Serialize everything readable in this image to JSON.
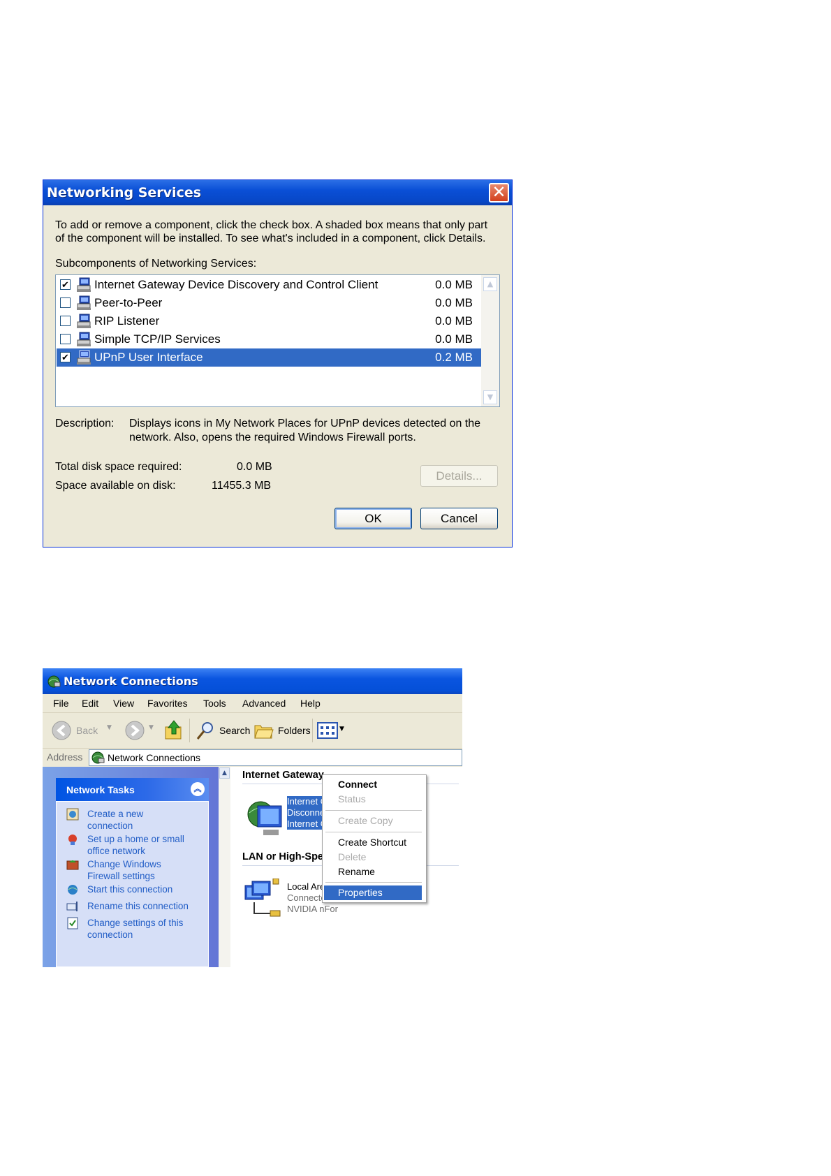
{
  "networking_services": {
    "title": "Networking Services",
    "instructions_line1": "To add or remove a component, click the check box. A shaded box means that only part",
    "instructions_line2": "of the component will be installed. To see what's included in a component, click Details.",
    "subcomponents_label": "Subcomponents of Networking Services:",
    "items": [
      {
        "name": "Internet Gateway Device Discovery and Control Client",
        "size": "0.0 MB",
        "checked": true
      },
      {
        "name": "Peer-to-Peer",
        "size": "0.0 MB",
        "checked": false
      },
      {
        "name": "RIP Listener",
        "size": "0.0 MB",
        "checked": false
      },
      {
        "name": "Simple TCP/IP Services",
        "size": "0.0 MB",
        "checked": false
      },
      {
        "name": "UPnP User Interface",
        "size": "0.2 MB",
        "checked": true,
        "selected": true
      }
    ],
    "description_label": "Description:",
    "description_line1": "Displays icons in My Network Places for UPnP devices detected on the",
    "description_line2": "network. Also, opens the required Windows Firewall ports.",
    "total_disk_label": "Total disk space required:",
    "total_disk_value": "0.0 MB",
    "space_available_label": "Space available on disk:",
    "space_available_value": "11455.3 MB",
    "details_button": "Details...",
    "ok_button": "OK",
    "cancel_button": "Cancel",
    "close_glyph": "✕"
  },
  "network_connections": {
    "title": "Network Connections",
    "menu": [
      "File",
      "Edit",
      "View",
      "Favorites",
      "Tools",
      "Advanced",
      "Help"
    ],
    "toolbar": {
      "back": "Back",
      "search": "Search",
      "folders": "Folders"
    },
    "address_label": "Address",
    "address_value": "Network Connections",
    "tasks_header": "Network Tasks",
    "tasks": [
      {
        "line1": "Create a new",
        "line2": "connection",
        "icon": "new-connection-icon"
      },
      {
        "line1": "Set up a home or small",
        "line2": "office network",
        "icon": "home-network-icon"
      },
      {
        "line1": "Change Windows",
        "line2": "Firewall settings",
        "icon": "firewall-icon"
      },
      {
        "line1": "Start this connection",
        "line2": "",
        "icon": "start-connection-icon"
      },
      {
        "line1": "Rename this connection",
        "line2": "",
        "icon": "rename-icon"
      },
      {
        "line1": "Change settings of this",
        "line2": "connection",
        "icon": "settings-icon"
      }
    ],
    "group_internet_gateway": "Internet Gateway",
    "gateway_item": {
      "line1": "Internet Connection",
      "line2": "Disconnected",
      "line3": "Internet Con"
    },
    "group_lan": "LAN or High-Speed In",
    "lan_item": {
      "line1": "Local Area C",
      "line2": "Connected, I",
      "line3": "NVIDIA nFor"
    },
    "context_menu": [
      {
        "label": "Connect",
        "state": "bold"
      },
      {
        "label": "Status",
        "state": "disabled"
      },
      {
        "label": "Create Copy",
        "state": "disabled"
      },
      {
        "label": "Create Shortcut",
        "state": "normal"
      },
      {
        "label": "Delete",
        "state": "disabled"
      },
      {
        "label": "Rename",
        "state": "normal"
      },
      {
        "label": "Properties",
        "state": "selected"
      }
    ],
    "colors": {
      "selection": "#316ac5",
      "title_blue": "#0a55e0",
      "task_link": "#215dc6"
    }
  }
}
